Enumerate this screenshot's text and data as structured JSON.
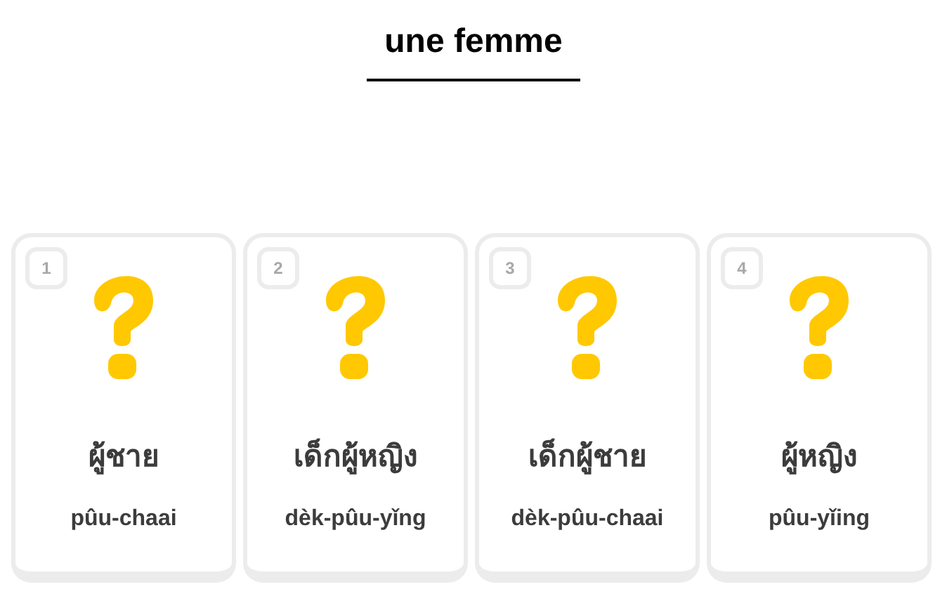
{
  "prompt": "une femme",
  "cards": [
    {
      "number": "1",
      "word": "ผู้ชาย",
      "romanization": "pûu-chaai",
      "selected": false
    },
    {
      "number": "2",
      "word": "เด็กผู้หญิง",
      "romanization": "dèk-pûu-yǐng",
      "selected": false
    },
    {
      "number": "3",
      "word": "เด็กผู้ชาย",
      "romanization": "dèk-pûu-chaai",
      "selected": false
    },
    {
      "number": "4",
      "word": "ผู้หญิง",
      "romanization": "pûu-yǐing",
      "selected": false
    }
  ]
}
